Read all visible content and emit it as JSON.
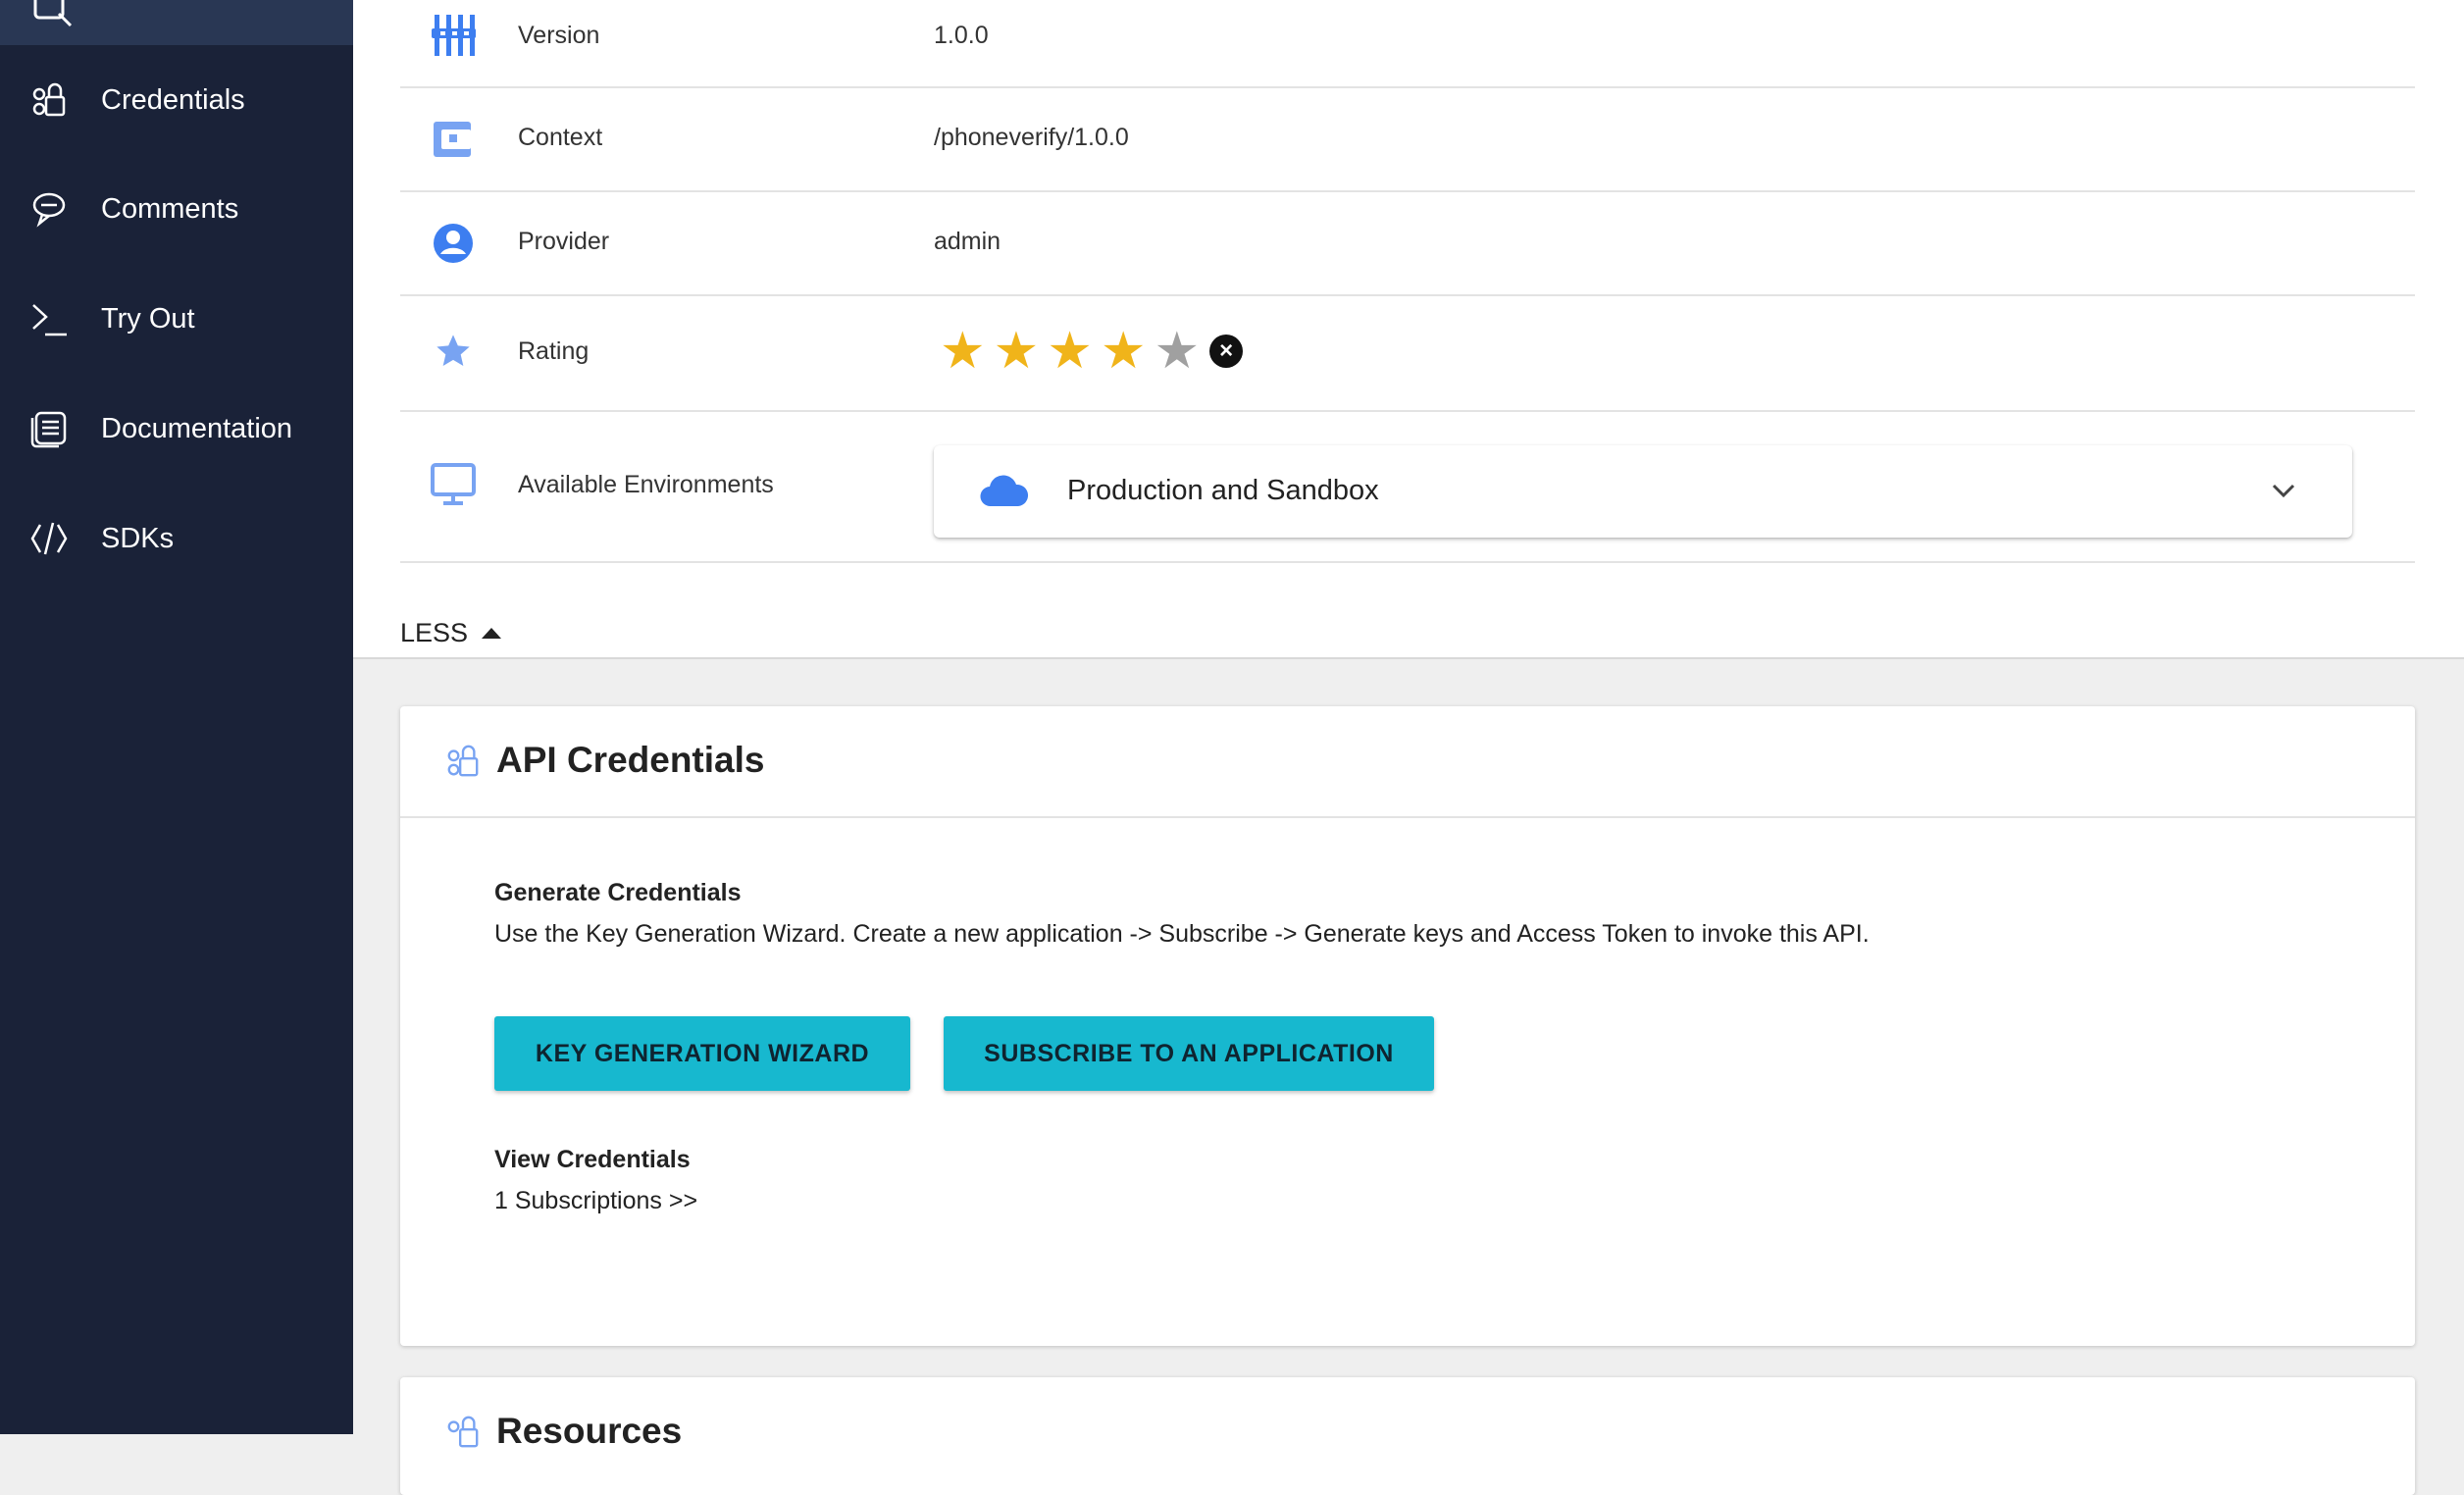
{
  "sidebar": {
    "items": [
      {
        "label": "Credentials",
        "icon": "credentials-icon"
      },
      {
        "label": "Comments",
        "icon": "comments-icon"
      },
      {
        "label": "Try Out",
        "icon": "terminal-icon"
      },
      {
        "label": "Documentation",
        "icon": "documentation-icon"
      },
      {
        "label": "SDKs",
        "icon": "code-icon"
      }
    ]
  },
  "details": {
    "version": {
      "label": "Version",
      "value": "1.0.0"
    },
    "context": {
      "label": "Context",
      "value": "/phoneverify/1.0.0"
    },
    "provider": {
      "label": "Provider",
      "value": "admin"
    },
    "rating": {
      "label": "Rating",
      "value": 4,
      "max": 5
    },
    "environments": {
      "label": "Available Environments",
      "selected": "Production and Sandbox"
    }
  },
  "less_label": "LESS",
  "credentials_card": {
    "title": "API Credentials",
    "generate_title": "Generate Credentials",
    "generate_text": "Use the Key Generation Wizard. Create a new application -> Subscribe -> Generate keys and Access Token to invoke this API.",
    "wizard_button": "KEY GENERATION WIZARD",
    "subscribe_button": "SUBSCRIBE TO AN APPLICATION",
    "view_title": "View Credentials",
    "subscriptions_link": "1 Subscriptions >>"
  },
  "resources_card": {
    "title": "Resources"
  },
  "colors": {
    "sidebar_bg": "#1a2238",
    "accent_blue": "#3d7ef0",
    "button_teal": "#17b8cf",
    "star_gold": "#f0b41a"
  }
}
